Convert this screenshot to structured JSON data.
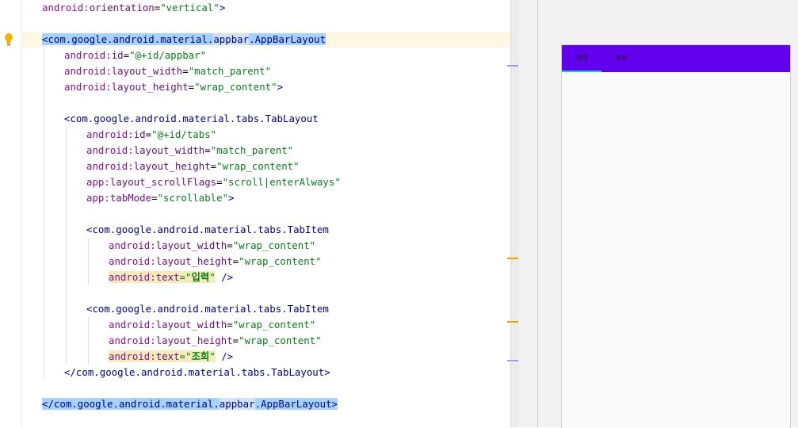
{
  "editor": {
    "lines": [
      {
        "segments": [
          {
            "text": "android:",
            "cls": "ans"
          },
          {
            "text": "orientation",
            "cls": "a"
          },
          {
            "text": "=",
            "cls": "p"
          },
          {
            "text": "\"vertical\"",
            "cls": "v"
          },
          {
            "text": ">",
            "cls": "t"
          }
        ]
      },
      {
        "segments": []
      },
      {
        "segments": [
          {
            "text": "<com.google.android.material.",
            "cls": "t hl"
          },
          {
            "text": "appbar",
            "cls": "t hl2"
          },
          {
            "text": ".AppBarLayout",
            "cls": "t hl"
          }
        ]
      },
      {
        "segments": [
          {
            "text": "android:",
            "cls": "ans"
          },
          {
            "text": "id",
            "cls": "a"
          },
          {
            "text": "=",
            "cls": "p"
          },
          {
            "text": "\"@+id/appbar\"",
            "cls": "v"
          }
        ]
      },
      {
        "segments": [
          {
            "text": "android:",
            "cls": "ans"
          },
          {
            "text": "layout_width",
            "cls": "a"
          },
          {
            "text": "=",
            "cls": "p"
          },
          {
            "text": "\"match_parent\"",
            "cls": "v"
          }
        ]
      },
      {
        "segments": [
          {
            "text": "android:",
            "cls": "ans"
          },
          {
            "text": "layout_height",
            "cls": "a"
          },
          {
            "text": "=",
            "cls": "p"
          },
          {
            "text": "\"wrap_content\"",
            "cls": "v"
          },
          {
            "text": ">",
            "cls": "t"
          }
        ]
      },
      {
        "segments": []
      },
      {
        "segments": [
          {
            "text": "<com.google.android.material.tabs.TabLayout",
            "cls": "t"
          }
        ]
      },
      {
        "segments": [
          {
            "text": "android:",
            "cls": "ans"
          },
          {
            "text": "id",
            "cls": "a"
          },
          {
            "text": "=",
            "cls": "p"
          },
          {
            "text": "\"@+id/tabs\"",
            "cls": "v"
          }
        ]
      },
      {
        "segments": [
          {
            "text": "android:",
            "cls": "ans"
          },
          {
            "text": "layout_width",
            "cls": "a"
          },
          {
            "text": "=",
            "cls": "p"
          },
          {
            "text": "\"match_parent\"",
            "cls": "v"
          }
        ]
      },
      {
        "segments": [
          {
            "text": "android:",
            "cls": "ans"
          },
          {
            "text": "layout_height",
            "cls": "a"
          },
          {
            "text": "=",
            "cls": "p"
          },
          {
            "text": "\"wrap_content\"",
            "cls": "v"
          }
        ]
      },
      {
        "segments": [
          {
            "text": "app:",
            "cls": "ans"
          },
          {
            "text": "layout_scrollFlags",
            "cls": "a"
          },
          {
            "text": "=",
            "cls": "p"
          },
          {
            "text": "\"scroll|enterAlways\"",
            "cls": "v"
          }
        ]
      },
      {
        "segments": [
          {
            "text": "app:",
            "cls": "ans"
          },
          {
            "text": "tabMode",
            "cls": "a"
          },
          {
            "text": "=",
            "cls": "p"
          },
          {
            "text": "\"scrollable\"",
            "cls": "v"
          },
          {
            "text": ">",
            "cls": "t"
          }
        ]
      },
      {
        "segments": []
      },
      {
        "segments": [
          {
            "text": "<com.google.android.material.tabs.TabItem",
            "cls": "t"
          }
        ]
      },
      {
        "segments": [
          {
            "text": "android:",
            "cls": "ans"
          },
          {
            "text": "layout_width",
            "cls": "a"
          },
          {
            "text": "=",
            "cls": "p"
          },
          {
            "text": "\"wrap_content\"",
            "cls": "v"
          }
        ]
      },
      {
        "segments": [
          {
            "text": "android:",
            "cls": "ans"
          },
          {
            "text": "layout_height",
            "cls": "a"
          },
          {
            "text": "=",
            "cls": "p"
          },
          {
            "text": "\"wrap_content\"",
            "cls": "v"
          }
        ]
      },
      {
        "segments": [
          {
            "text": "android:",
            "cls": "ans warn"
          },
          {
            "text": "text",
            "cls": "a warn"
          },
          {
            "text": "=\"",
            "cls": "v warn"
          },
          {
            "text": "입력",
            "cls": "v warn bold"
          },
          {
            "text": "\"",
            "cls": "v warn"
          },
          {
            "text": " />",
            "cls": "t"
          }
        ]
      },
      {
        "segments": []
      },
      {
        "segments": [
          {
            "text": "<com.google.android.material.tabs.TabItem",
            "cls": "t"
          }
        ]
      },
      {
        "segments": [
          {
            "text": "android:",
            "cls": "ans"
          },
          {
            "text": "layout_width",
            "cls": "a"
          },
          {
            "text": "=",
            "cls": "p"
          },
          {
            "text": "\"wrap_content\"",
            "cls": "v"
          }
        ]
      },
      {
        "segments": [
          {
            "text": "android:",
            "cls": "ans"
          },
          {
            "text": "layout_height",
            "cls": "a"
          },
          {
            "text": "=",
            "cls": "p"
          },
          {
            "text": "\"wrap_content\"",
            "cls": "v"
          }
        ]
      },
      {
        "segments": [
          {
            "text": "android:",
            "cls": "ans warn"
          },
          {
            "text": "text",
            "cls": "a warn"
          },
          {
            "text": "=\"",
            "cls": "v warn"
          },
          {
            "text": "조회",
            "cls": "v warn bold"
          },
          {
            "text": "\"",
            "cls": "v warn"
          },
          {
            "text": " />",
            "cls": "t"
          }
        ]
      },
      {
        "segments": [
          {
            "text": "</com.google.android.material.tabs.TabLayout>",
            "cls": "t"
          }
        ]
      },
      {
        "segments": []
      },
      {
        "segments": [
          {
            "text": "</com.google.android.material.",
            "cls": "t hl"
          },
          {
            "text": "appbar",
            "cls": "t hl2"
          },
          {
            "text": ".AppBarLayout>",
            "cls": "t hl"
          }
        ]
      }
    ]
  },
  "gutter": {
    "intention_icon": "lightbulb-icon",
    "icon_color": "#f0b400"
  },
  "scrollbar_marks": {
    "warning_color": "#e0a800",
    "change_color": "#9aa0f0"
  },
  "preview": {
    "appbar_color": "#6200ee",
    "indicator_color": "#03dac5",
    "tabs": [
      {
        "label": "입력"
      },
      {
        "label": "조회"
      }
    ]
  }
}
